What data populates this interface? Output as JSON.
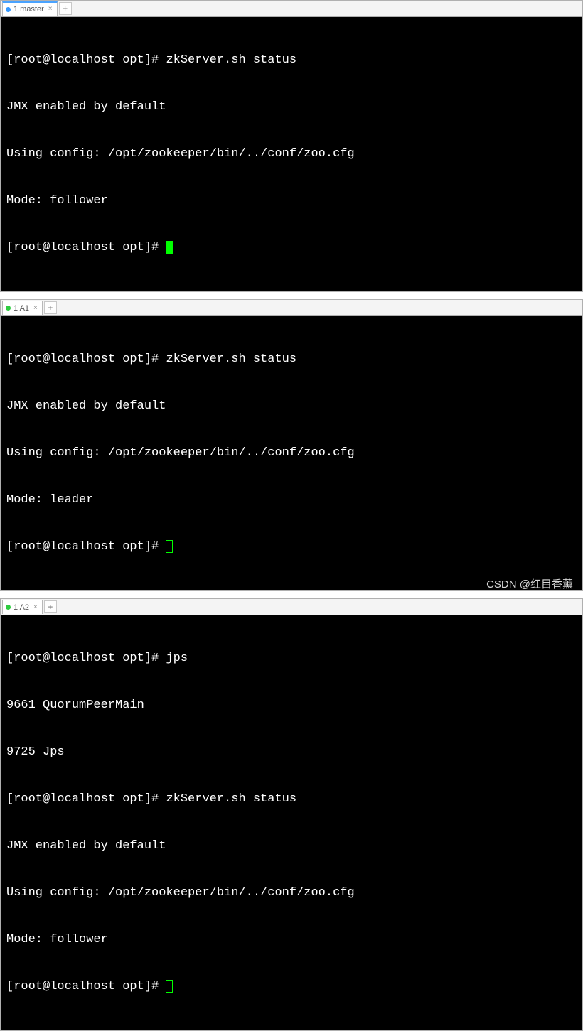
{
  "panes": [
    {
      "tab": {
        "label": "1 master",
        "dot": "blue",
        "active": true
      },
      "lines": [
        {
          "prompt": "[root@localhost opt]# ",
          "cmd": "zkServer.sh status"
        },
        {
          "text": "JMX enabled by default"
        },
        {
          "text": "Using config: /opt/zookeeper/bin/../conf/zoo.cfg"
        },
        {
          "text": "Mode: follower"
        },
        {
          "prompt": "[root@localhost opt]# ",
          "cursor": "block"
        }
      ]
    },
    {
      "tab": {
        "label": "1 A1",
        "dot": "green",
        "active": false
      },
      "lines": [
        {
          "prompt": "[root@localhost opt]# ",
          "cmd": "zkServer.sh status"
        },
        {
          "text": "JMX enabled by default"
        },
        {
          "text": "Using config: /opt/zookeeper/bin/../conf/zoo.cfg"
        },
        {
          "text": "Mode: leader"
        },
        {
          "prompt": "[root@localhost opt]# ",
          "cursor": "hollow"
        }
      ]
    },
    {
      "tab": {
        "label": "1 A2",
        "dot": "green",
        "active": false
      },
      "lines": [
        {
          "prompt": "[root@localhost opt]# ",
          "cmd": "jps"
        },
        {
          "text": "9661 QuorumPeerMain"
        },
        {
          "text": "9725 Jps"
        },
        {
          "prompt": "[root@localhost opt]# ",
          "cmd": "zkServer.sh status"
        },
        {
          "text": "JMX enabled by default"
        },
        {
          "text": "Using config: /opt/zookeeper/bin/../conf/zoo.cfg"
        },
        {
          "text": "Mode: follower"
        },
        {
          "prompt": "[root@localhost opt]# ",
          "cursor": "hollow"
        }
      ]
    }
  ],
  "watermark": "CSDN @红目香薰"
}
